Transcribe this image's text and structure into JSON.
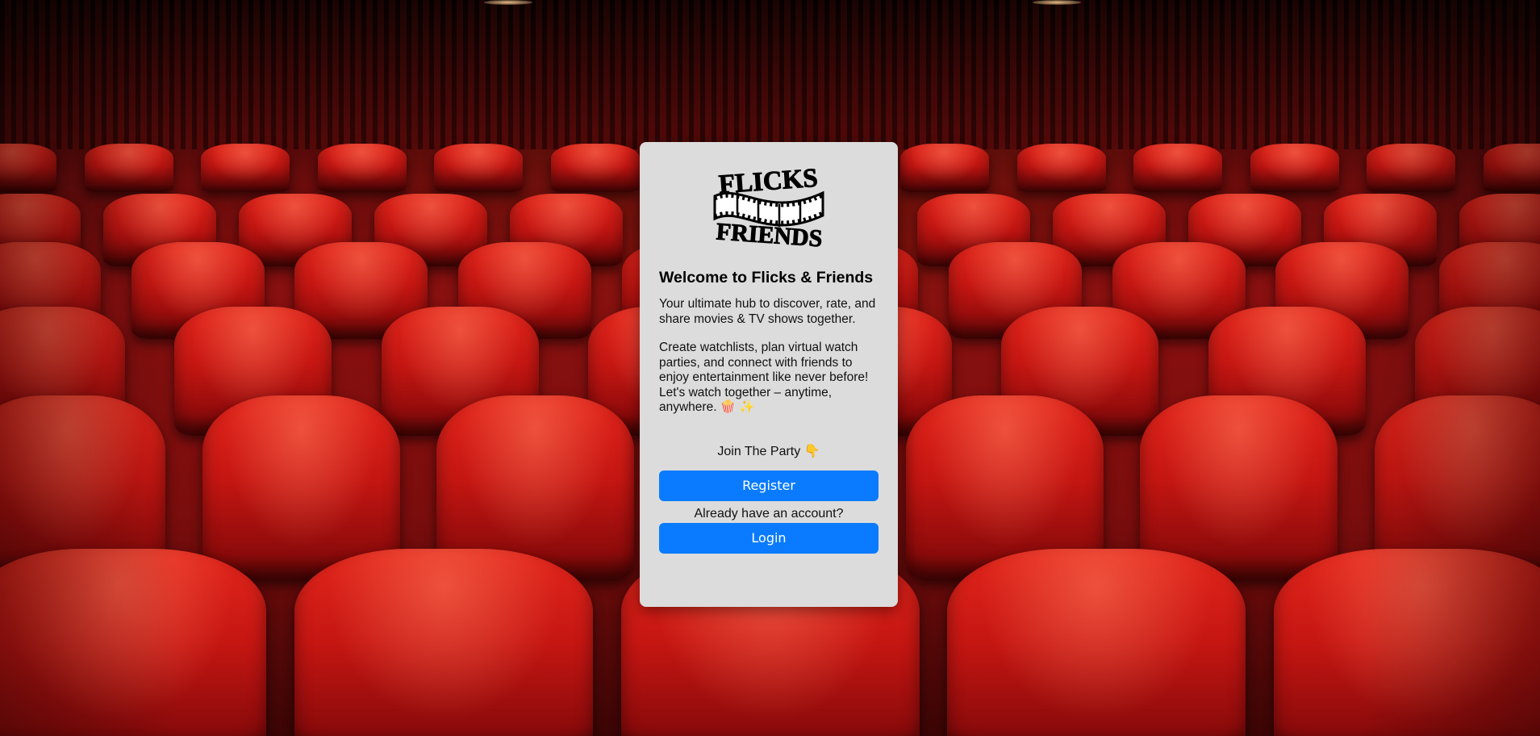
{
  "colors": {
    "accent": "#0a7bff",
    "card_background": "#dcdcdc",
    "seat_red": "#c51612"
  },
  "logo": {
    "line1": "FLICKS",
    "line2": "FRIENDS",
    "icon": "film-strip-icon"
  },
  "welcome": {
    "title": "Welcome to Flicks & Friends",
    "paragraph1": "Your ultimate hub to discover, rate, and share movies & TV shows together.",
    "paragraph2": "Create watchlists, plan virtual watch parties, and connect with friends to enjoy entertainment like never before! Let's watch together – anytime, anywhere. 🍿 ✨"
  },
  "actions": {
    "join_text": "Join The Party 👇",
    "register_label": "Register",
    "already_text": "Already have an account?",
    "login_label": "Login"
  }
}
